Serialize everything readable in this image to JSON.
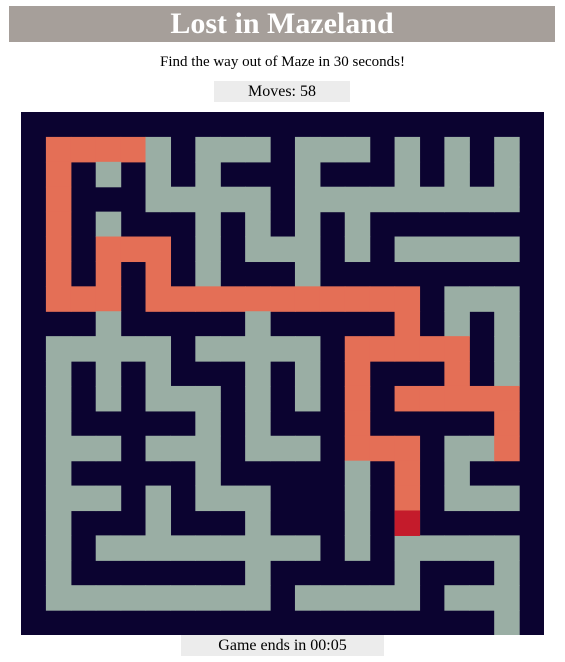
{
  "header": {
    "title": "Lost in Mazeland",
    "subtitle": "Find the way out of Maze in 30 seconds!"
  },
  "stats": {
    "moves_label": "Moves:",
    "moves_value": "58"
  },
  "footer": {
    "timer_label": "Game ends in",
    "timer_value": "00:05"
  },
  "colors": {
    "title_bar_bg": "#a69f9a",
    "wall": "#0b0330",
    "passage": "#9aaea4",
    "visited_path": "#e46f56",
    "player": "#c41b2b",
    "info_box_bg": "#ececec"
  },
  "maze": {
    "rows": 21,
    "cols": 21,
    "player": [
      16,
      15
    ],
    "open_cells": [
      [
        1,
        1
      ],
      [
        1,
        2
      ],
      [
        1,
        3
      ],
      [
        1,
        4
      ],
      [
        1,
        5
      ],
      [
        1,
        7
      ],
      [
        1,
        8
      ],
      [
        1,
        9
      ],
      [
        1,
        11
      ],
      [
        1,
        12
      ],
      [
        1,
        13
      ],
      [
        1,
        15
      ],
      [
        1,
        17
      ],
      [
        1,
        19
      ],
      [
        2,
        1
      ],
      [
        2,
        3
      ],
      [
        2,
        5
      ],
      [
        2,
        7
      ],
      [
        2,
        11
      ],
      [
        2,
        15
      ],
      [
        2,
        17
      ],
      [
        2,
        19
      ],
      [
        3,
        1
      ],
      [
        3,
        5
      ],
      [
        3,
        6
      ],
      [
        3,
        7
      ],
      [
        3,
        8
      ],
      [
        3,
        9
      ],
      [
        3,
        11
      ],
      [
        3,
        12
      ],
      [
        3,
        13
      ],
      [
        3,
        14
      ],
      [
        3,
        15
      ],
      [
        3,
        16
      ],
      [
        3,
        17
      ],
      [
        3,
        18
      ],
      [
        3,
        19
      ],
      [
        4,
        1
      ],
      [
        4,
        3
      ],
      [
        4,
        7
      ],
      [
        4,
        9
      ],
      [
        4,
        11
      ],
      [
        4,
        13
      ],
      [
        5,
        1
      ],
      [
        5,
        3
      ],
      [
        5,
        4
      ],
      [
        5,
        5
      ],
      [
        5,
        7
      ],
      [
        5,
        9
      ],
      [
        5,
        10
      ],
      [
        5,
        11
      ],
      [
        5,
        13
      ],
      [
        5,
        15
      ],
      [
        5,
        16
      ],
      [
        5,
        17
      ],
      [
        5,
        18
      ],
      [
        5,
        19
      ],
      [
        6,
        1
      ],
      [
        6,
        3
      ],
      [
        6,
        5
      ],
      [
        6,
        7
      ],
      [
        6,
        11
      ],
      [
        7,
        1
      ],
      [
        7,
        2
      ],
      [
        7,
        3
      ],
      [
        7,
        5
      ],
      [
        7,
        6
      ],
      [
        7,
        7
      ],
      [
        7,
        8
      ],
      [
        7,
        9
      ],
      [
        7,
        10
      ],
      [
        7,
        11
      ],
      [
        7,
        12
      ],
      [
        7,
        13
      ],
      [
        7,
        14
      ],
      [
        7,
        15
      ],
      [
        7,
        17
      ],
      [
        7,
        18
      ],
      [
        7,
        19
      ],
      [
        8,
        3
      ],
      [
        8,
        9
      ],
      [
        8,
        15
      ],
      [
        8,
        17
      ],
      [
        8,
        19
      ],
      [
        9,
        1
      ],
      [
        9,
        2
      ],
      [
        9,
        3
      ],
      [
        9,
        4
      ],
      [
        9,
        5
      ],
      [
        9,
        7
      ],
      [
        9,
        8
      ],
      [
        9,
        9
      ],
      [
        9,
        10
      ],
      [
        9,
        11
      ],
      [
        9,
        13
      ],
      [
        9,
        14
      ],
      [
        9,
        15
      ],
      [
        9,
        16
      ],
      [
        9,
        17
      ],
      [
        9,
        19
      ],
      [
        10,
        1
      ],
      [
        10,
        3
      ],
      [
        10,
        5
      ],
      [
        10,
        9
      ],
      [
        10,
        11
      ],
      [
        10,
        13
      ],
      [
        10,
        17
      ],
      [
        10,
        19
      ],
      [
        11,
        1
      ],
      [
        11,
        3
      ],
      [
        11,
        5
      ],
      [
        11,
        6
      ],
      [
        11,
        7
      ],
      [
        11,
        9
      ],
      [
        11,
        11
      ],
      [
        11,
        13
      ],
      [
        11,
        15
      ],
      [
        11,
        16
      ],
      [
        11,
        17
      ],
      [
        11,
        18
      ],
      [
        11,
        19
      ],
      [
        12,
        1
      ],
      [
        12,
        7
      ],
      [
        12,
        9
      ],
      [
        12,
        13
      ],
      [
        12,
        19
      ],
      [
        13,
        1
      ],
      [
        13,
        2
      ],
      [
        13,
        3
      ],
      [
        13,
        5
      ],
      [
        13,
        6
      ],
      [
        13,
        7
      ],
      [
        13,
        9
      ],
      [
        13,
        10
      ],
      [
        13,
        11
      ],
      [
        13,
        13
      ],
      [
        13,
        14
      ],
      [
        13,
        15
      ],
      [
        13,
        17
      ],
      [
        13,
        18
      ],
      [
        13,
        19
      ],
      [
        14,
        1
      ],
      [
        14,
        7
      ],
      [
        14,
        13
      ],
      [
        14,
        15
      ],
      [
        14,
        17
      ],
      [
        15,
        1
      ],
      [
        15,
        2
      ],
      [
        15,
        3
      ],
      [
        15,
        5
      ],
      [
        15,
        7
      ],
      [
        15,
        8
      ],
      [
        15,
        9
      ],
      [
        15,
        13
      ],
      [
        15,
        15
      ],
      [
        15,
        17
      ],
      [
        15,
        18
      ],
      [
        15,
        19
      ],
      [
        16,
        1
      ],
      [
        16,
        5
      ],
      [
        16,
        9
      ],
      [
        16,
        13
      ],
      [
        16,
        15
      ],
      [
        17,
        1
      ],
      [
        17,
        3
      ],
      [
        17,
        4
      ],
      [
        17,
        5
      ],
      [
        17,
        6
      ],
      [
        17,
        7
      ],
      [
        17,
        8
      ],
      [
        17,
        9
      ],
      [
        17,
        10
      ],
      [
        17,
        11
      ],
      [
        17,
        13
      ],
      [
        17,
        15
      ],
      [
        17,
        16
      ],
      [
        17,
        17
      ],
      [
        17,
        18
      ],
      [
        17,
        19
      ],
      [
        18,
        1
      ],
      [
        18,
        9
      ],
      [
        18,
        15
      ],
      [
        18,
        19
      ],
      [
        19,
        1
      ],
      [
        19,
        2
      ],
      [
        19,
        3
      ],
      [
        19,
        4
      ],
      [
        19,
        5
      ],
      [
        19,
        6
      ],
      [
        19,
        7
      ],
      [
        19,
        8
      ],
      [
        19,
        9
      ],
      [
        19,
        11
      ],
      [
        19,
        12
      ],
      [
        19,
        13
      ],
      [
        19,
        14
      ],
      [
        19,
        15
      ],
      [
        19,
        17
      ],
      [
        19,
        18
      ],
      [
        19,
        19
      ],
      [
        20,
        19
      ]
    ],
    "visited_cells": [
      [
        1,
        1
      ],
      [
        1,
        2
      ],
      [
        1,
        3
      ],
      [
        1,
        4
      ],
      [
        2,
        1
      ],
      [
        3,
        1
      ],
      [
        4,
        1
      ],
      [
        5,
        1
      ],
      [
        6,
        1
      ],
      [
        7,
        1
      ],
      [
        7,
        2
      ],
      [
        7,
        3
      ],
      [
        6,
        3
      ],
      [
        5,
        3
      ],
      [
        5,
        4
      ],
      [
        5,
        5
      ],
      [
        6,
        5
      ],
      [
        7,
        5
      ],
      [
        7,
        6
      ],
      [
        7,
        7
      ],
      [
        7,
        8
      ],
      [
        7,
        9
      ],
      [
        7,
        10
      ],
      [
        7,
        11
      ],
      [
        7,
        12
      ],
      [
        7,
        13
      ],
      [
        7,
        14
      ],
      [
        7,
        15
      ],
      [
        8,
        15
      ],
      [
        9,
        15
      ],
      [
        9,
        14
      ],
      [
        9,
        13
      ],
      [
        9,
        16
      ],
      [
        9,
        17
      ],
      [
        10,
        13
      ],
      [
        11,
        13
      ],
      [
        12,
        13
      ],
      [
        13,
        13
      ],
      [
        13,
        14
      ],
      [
        13,
        15
      ],
      [
        14,
        15
      ],
      [
        15,
        15
      ],
      [
        10,
        17
      ],
      [
        11,
        17
      ],
      [
        11,
        16
      ],
      [
        11,
        15
      ],
      [
        11,
        18
      ],
      [
        11,
        19
      ],
      [
        12,
        19
      ],
      [
        13,
        19
      ]
    ]
  }
}
